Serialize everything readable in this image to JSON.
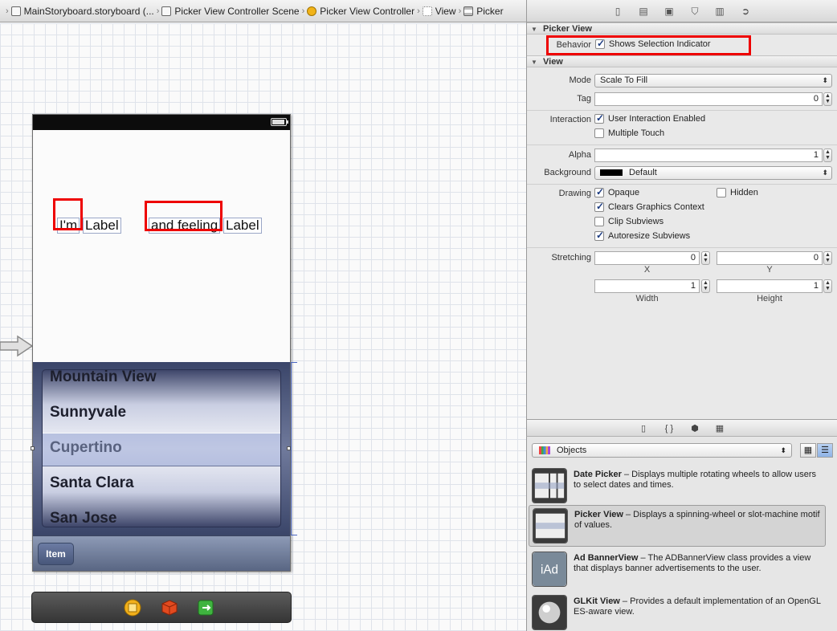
{
  "breadcrumb": [
    {
      "label": "MainStoryboard.storyboard (...",
      "icon": "storyboard-icon"
    },
    {
      "label": "Picker View Controller Scene",
      "icon": "scene-icon"
    },
    {
      "label": "Picker View Controller",
      "icon": "view-controller-icon"
    },
    {
      "label": "View",
      "icon": "view-icon"
    },
    {
      "label": "Picker",
      "icon": "picker-icon"
    }
  ],
  "canvas": {
    "labels": [
      "I'm",
      "Label",
      "and feeling",
      "Label"
    ],
    "picker_rows": [
      "Mountain View",
      "Sunnyvale",
      "Cupertino",
      "Santa Clara",
      "San Jose"
    ],
    "toolbar_item": "Item"
  },
  "inspector": {
    "picker_section": "Picker View",
    "behavior_label": "Behavior",
    "shows_selection_indicator": "Shows Selection Indicator",
    "view_section": "View",
    "mode_label": "Mode",
    "mode_value": "Scale To Fill",
    "tag_label": "Tag",
    "tag_value": "0",
    "interaction_label": "Interaction",
    "user_interaction": "User Interaction Enabled",
    "multiple_touch": "Multiple Touch",
    "alpha_label": "Alpha",
    "alpha_value": "1",
    "background_label": "Background",
    "background_value": "Default",
    "drawing_label": "Drawing",
    "opaque": "Opaque",
    "hidden": "Hidden",
    "clears_graphics": "Clears Graphics Context",
    "clip_subviews": "Clip Subviews",
    "autoresize": "Autoresize Subviews",
    "stretching_label": "Stretching",
    "stretch_x": "0",
    "stretch_y": "0",
    "stretch_w": "1",
    "stretch_h": "1",
    "x_caption": "X",
    "y_caption": "Y",
    "width_caption": "Width",
    "height_caption": "Height"
  },
  "library": {
    "selector": "Objects",
    "items": [
      {
        "title": "Date Picker",
        "desc": " – Displays multiple rotating wheels to allow users to select dates and times."
      },
      {
        "title": "Picker View",
        "desc": " – Displays a spinning-wheel or slot-machine motif of values."
      },
      {
        "title": "Ad BannerView",
        "desc": " – The ADBannerView class provides a view that displays banner advertisements to the user."
      },
      {
        "title": "GLKit View",
        "desc": " – Provides a default implementation of an OpenGL ES-aware view."
      }
    ],
    "iad_text": "iAd"
  },
  "colors": {
    "highlight": "#e00000",
    "picker": "#4b557a"
  }
}
